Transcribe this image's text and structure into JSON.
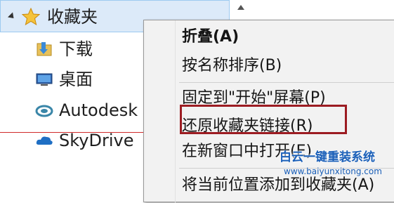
{
  "nav": {
    "favorites_label": "收藏夹",
    "items": [
      {
        "label": "下载",
        "icon": "downloads-folder-icon"
      },
      {
        "label": "桌面",
        "icon": "desktop-icon"
      },
      {
        "label": "Autodesk",
        "icon": "autodesk-icon"
      },
      {
        "label": "SkyDrive",
        "icon": "skydrive-cloud-icon"
      }
    ]
  },
  "context_menu": {
    "items": [
      {
        "label": "折叠(A)",
        "bold": true
      },
      {
        "label": "按名称排序(B)"
      },
      {
        "label": "固定到\"开始\"屏幕(P)"
      },
      {
        "label": "还原收藏夹链接(R)",
        "highlighted": true
      },
      {
        "label": "在新窗口中打开(E)"
      },
      {
        "label": "将当前位置添加到收藏夹(A)"
      }
    ]
  },
  "watermark": {
    "title": "白云一键重装系统",
    "url": "www.baiyunxitong.com"
  },
  "colors": {
    "selection_bg": "#dceaf9",
    "selection_border": "#9ccaf0",
    "menu_bg": "#f2f2f2",
    "highlight_border": "#9c1c22",
    "watermark": "#1a5fb8",
    "star": "#f5c33b"
  }
}
